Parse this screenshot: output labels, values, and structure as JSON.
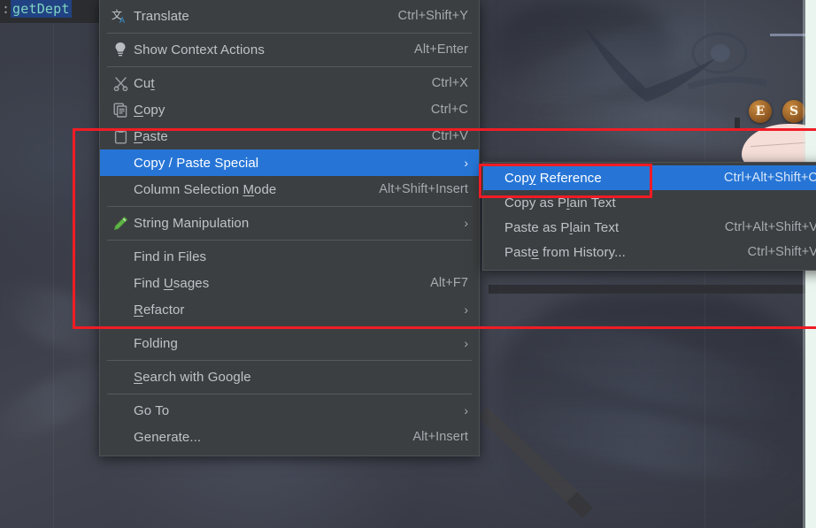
{
  "editor": {
    "gutter_char": ":",
    "selected_token": "getDept"
  },
  "colors": {
    "menu_bg": "#3c3f41",
    "menu_border": "#4e5254",
    "selection_blue": "#2675d6",
    "annotation_red": "#f01c25",
    "text": "#bfc3c7",
    "shortcut_text": "#a7aaae",
    "separator": "#56595b"
  },
  "context_menu": {
    "name": "editor-context-menu",
    "groups": [
      {
        "items": [
          {
            "label": "Translate",
            "shortcut": "Ctrl+Shift+Y",
            "icon": "translate-icon",
            "mnemonic": "",
            "arrow": "",
            "selected": false
          }
        ]
      },
      {
        "items": [
          {
            "label": "Show Context Actions",
            "shortcut": "Alt+Enter",
            "icon": "lightbulb-icon",
            "mnemonic": "",
            "arrow": "",
            "selected": false
          }
        ]
      },
      {
        "items": [
          {
            "label": "Cut",
            "shortcut": "Ctrl+X",
            "icon": "scissors-icon",
            "mnemonic": "t",
            "arrow": "",
            "selected": false
          },
          {
            "label": "Copy",
            "shortcut": "Ctrl+C",
            "icon": "copy-icon",
            "mnemonic": "C",
            "arrow": "",
            "selected": false
          },
          {
            "label": "Paste",
            "shortcut": "Ctrl+V",
            "icon": "clipboard-icon",
            "mnemonic": "P",
            "arrow": "",
            "selected": false
          },
          {
            "label": "Copy / Paste Special",
            "shortcut": "",
            "icon": "",
            "mnemonic": "",
            "arrow": "›",
            "selected": true
          },
          {
            "label": "Column Selection Mode",
            "shortcut": "Alt+Shift+Insert",
            "icon": "",
            "mnemonic": "M",
            "arrow": "",
            "selected": false
          }
        ]
      },
      {
        "items": [
          {
            "label": "String Manipulation",
            "shortcut": "",
            "icon": "pencil-icon",
            "mnemonic": "",
            "arrow": "›",
            "selected": false
          }
        ]
      },
      {
        "items": [
          {
            "label": "Find in Files",
            "shortcut": "",
            "icon": "",
            "mnemonic": "",
            "arrow": "",
            "selected": false
          },
          {
            "label": "Find Usages",
            "shortcut": "Alt+F7",
            "icon": "",
            "mnemonic": "U",
            "arrow": "",
            "selected": false
          },
          {
            "label": "Refactor",
            "shortcut": "",
            "icon": "",
            "mnemonic": "R",
            "arrow": "›",
            "selected": false
          }
        ]
      },
      {
        "items": [
          {
            "label": "Folding",
            "shortcut": "",
            "icon": "",
            "mnemonic": "",
            "arrow": "›",
            "selected": false
          }
        ]
      },
      {
        "items": [
          {
            "label": "Search with Google",
            "shortcut": "",
            "icon": "",
            "mnemonic": "S",
            "arrow": "",
            "selected": false
          }
        ]
      },
      {
        "items": [
          {
            "label": "Go To",
            "shortcut": "",
            "icon": "",
            "mnemonic": "",
            "arrow": "›",
            "selected": false
          },
          {
            "label": "Generate...",
            "shortcut": "Alt+Insert",
            "icon": "",
            "mnemonic": "",
            "arrow": "",
            "selected": false
          }
        ]
      }
    ]
  },
  "submenu": {
    "name": "copy-paste-special-submenu",
    "items": [
      {
        "label": "Copy Reference",
        "shortcut": "Ctrl+Alt+Shift+C",
        "mnemonic": "y",
        "selected": true
      },
      {
        "label": "Copy as Plain Text",
        "shortcut": "",
        "mnemonic": "l",
        "selected": false
      },
      {
        "label": "Paste as Plain Text",
        "shortcut": "Ctrl+Alt+Shift+V",
        "mnemonic": "l",
        "selected": false
      },
      {
        "label": "Paste from History...",
        "shortcut": "Ctrl+Shift+V",
        "mnemonic": "e",
        "selected": false
      }
    ]
  },
  "annotations": [
    {
      "name": "menu-region-highlight"
    },
    {
      "name": "copy-reference-highlight"
    }
  ],
  "badges": [
    {
      "letter": "E",
      "name": "badge-e"
    },
    {
      "letter": "S",
      "name": "badge-s"
    }
  ]
}
